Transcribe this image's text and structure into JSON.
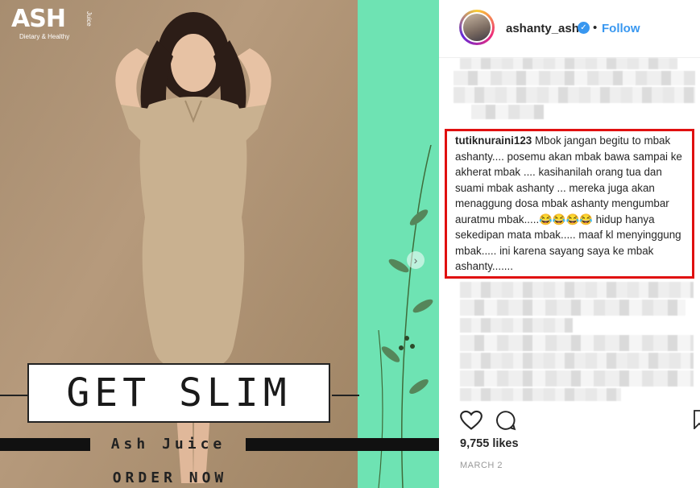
{
  "media": {
    "brand_logo": "ASH",
    "brand_tagline": "Dietary & Healthy",
    "brand_side": "Juice",
    "headline": "GET SLIM",
    "product_line": "Ash Juice",
    "cta": "ORDER NOW",
    "next_icon": "chevron-right-icon",
    "colors": {
      "accent_green": "#6ee3b3",
      "backdrop": "#a78d70"
    }
  },
  "post": {
    "username": "ashanty_ash",
    "verified_icon": "verified-badge-icon",
    "separator": "•",
    "follow_label": "Follow",
    "highlighted_comment": {
      "user": "tutiknuraini123",
      "text": " Mbok jangan begitu to mbak ashanty.... posemu akan mbak bawa sampai ke akherat mbak .... kasihanilah orang tua dan suami mbak ashanty ... mereka juga akan menaggung dosa mbak ashanty mengumbar auratmu mbak.....😂😂😂😂 hidup hanya sekedipan mata mbak..... maaf kl menyinggung mbak..... ini karena sayang saya ke mbak ashanty......."
    },
    "likes": "9,755 likes",
    "date": "MARCH 2",
    "colors": {
      "highlight_border": "#e01010",
      "follow": "#3897f0"
    }
  }
}
